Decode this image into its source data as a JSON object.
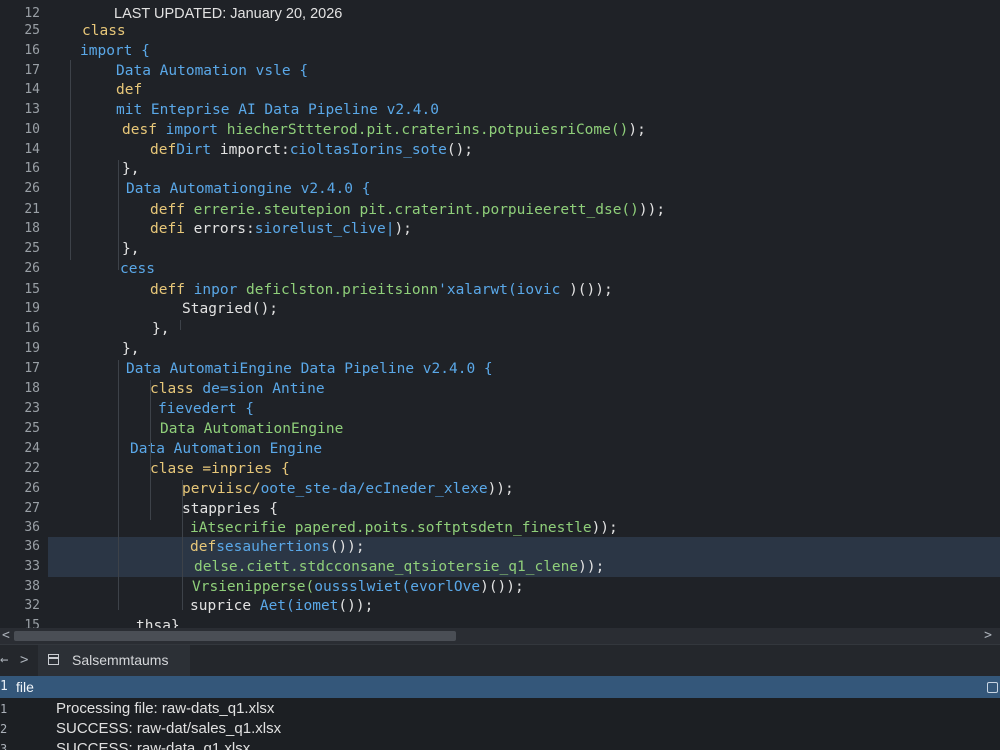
{
  "editor": {
    "lines": [
      {
        "n": "12",
        "segs": [
          {
            "t": "LAST UPDATED: January 20, 2026",
            "c": "c-white c-sans"
          }
        ]
      },
      {
        "n": "25",
        "segs": [
          {
            "t": "class",
            "c": "c-kw"
          }
        ]
      },
      {
        "n": "16",
        "segs": [
          {
            "t": "import {",
            "c": "c-blue"
          }
        ]
      },
      {
        "n": "17",
        "segs": [
          {
            "t": "Data Automation vsle {",
            "c": "c-blue"
          }
        ]
      },
      {
        "n": "14",
        "segs": [
          {
            "t": "def",
            "c": "c-kw"
          }
        ]
      },
      {
        "n": "13",
        "segs": [
          {
            "t": "mit Enteprise AI Data Pipeline v2.4.0",
            "c": "c-blue"
          }
        ]
      },
      {
        "n": "10",
        "segs": [
          {
            "t": "desf ",
            "c": "c-kw"
          },
          {
            "t": "import ",
            "c": "c-blue"
          },
          {
            "t": "hiecherSttterod.pit.craterins.potpuiesriCome()",
            "c": "c-green"
          },
          {
            "t": ");",
            "c": "c-white"
          }
        ]
      },
      {
        "n": "14",
        "segs": [
          {
            "t": "def",
            "c": "c-kw"
          },
          {
            "t": "Dirt ",
            "c": "c-blue"
          },
          {
            "t": "imporct:",
            "c": "c-white"
          },
          {
            "t": "cioltasIorins_sote",
            "c": "c-blue"
          },
          {
            "t": "();",
            "c": "c-white"
          }
        ]
      },
      {
        "n": "16",
        "segs": [
          {
            "t": "},",
            "c": "c-white"
          }
        ]
      },
      {
        "n": "26",
        "segs": [
          {
            "t": "Data Automationgine v2.4.0 {",
            "c": "c-blue"
          }
        ]
      },
      {
        "n": "21",
        "segs": [
          {
            "t": "deff ",
            "c": "c-kw"
          },
          {
            "t": "errerie.steutepion ",
            "c": "c-green"
          },
          {
            "t": "pit.craterint.porpuieerett_dse()",
            "c": "c-green"
          },
          {
            "t": "));",
            "c": "c-white"
          }
        ]
      },
      {
        "n": "18",
        "segs": [
          {
            "t": "defi ",
            "c": "c-kw"
          },
          {
            "t": "errors:",
            "c": "c-white"
          },
          {
            "t": "siorelust_clive|",
            "c": "c-blue"
          },
          {
            "t": ");",
            "c": "c-white"
          }
        ]
      },
      {
        "n": "25",
        "segs": [
          {
            "t": "},",
            "c": "c-white"
          }
        ]
      },
      {
        "n": "26",
        "segs": [
          {
            "t": "cess",
            "c": "c-blue"
          }
        ]
      },
      {
        "n": "15",
        "segs": [
          {
            "t": "deff ",
            "c": "c-kw"
          },
          {
            "t": "inpor ",
            "c": "c-blue"
          },
          {
            "t": "deficlston.prieitsionn",
            "c": "c-green"
          },
          {
            "t": "'xalarwt(iovic ",
            "c": "c-blue"
          },
          {
            "t": ")());",
            "c": "c-white"
          }
        ]
      },
      {
        "n": "19",
        "segs": [
          {
            "t": "Stagried",
            "c": "c-white"
          },
          {
            "t": "();",
            "c": "c-white"
          }
        ]
      },
      {
        "n": "16",
        "segs": [
          {
            "t": "},",
            "c": "c-white"
          }
        ]
      },
      {
        "n": "19",
        "segs": [
          {
            "t": "},",
            "c": "c-white"
          }
        ]
      },
      {
        "n": "17",
        "segs": [
          {
            "t": "Data AutomatiEngine Data Pipeline v2.4.0 {",
            "c": "c-blue"
          }
        ]
      },
      {
        "n": "18",
        "segs": [
          {
            "t": "class ",
            "c": "c-kw"
          },
          {
            "t": "de=sion Antine",
            "c": "c-blue"
          }
        ]
      },
      {
        "n": "23",
        "segs": [
          {
            "t": "fievedert {",
            "c": "c-blue"
          }
        ]
      },
      {
        "n": "25",
        "segs": [
          {
            "t": "Data AutomationEngine",
            "c": "c-green"
          }
        ]
      },
      {
        "n": "24",
        "segs": [
          {
            "t": "Data Automation Engine",
            "c": "c-blue"
          }
        ]
      },
      {
        "n": "22",
        "segs": [
          {
            "t": "clase =inpries {",
            "c": "c-kw"
          }
        ]
      },
      {
        "n": "26",
        "segs": [
          {
            "t": "perviisc/",
            "c": "c-kw"
          },
          {
            "t": "oote_ste-da/ecIneder_xlexe",
            "c": "c-blue"
          },
          {
            "t": "));",
            "c": "c-white"
          }
        ]
      },
      {
        "n": "27",
        "segs": [
          {
            "t": "stappries {",
            "c": "c-white"
          }
        ]
      },
      {
        "n": "36",
        "segs": [
          {
            "t": "iAtsecrifie papered.poits.softptsdetn_finestle",
            "c": "c-green"
          },
          {
            "t": "));",
            "c": "c-white"
          }
        ]
      },
      {
        "n": "36",
        "segs": [
          {
            "t": "def",
            "c": "c-kw"
          },
          {
            "t": "sesauhertions",
            "c": "c-blue"
          },
          {
            "t": "());",
            "c": "c-white"
          }
        ]
      },
      {
        "n": "33",
        "segs": [
          {
            "t": "delse.ciett.stdcconsane_qtsiotersie_q1_clene",
            "c": "c-green"
          },
          {
            "t": "));",
            "c": "c-white"
          }
        ]
      },
      {
        "n": "38",
        "segs": [
          {
            "t": "Vrsienipperse(",
            "c": "c-green"
          },
          {
            "t": "oussslwiet(evorlOve",
            "c": "c-blue"
          },
          {
            "t": ")());",
            "c": "c-white"
          }
        ]
      },
      {
        "n": "32",
        "segs": [
          {
            "t": "suprice ",
            "c": "c-white"
          },
          {
            "t": "Aet(iomet",
            "c": "c-blue"
          },
          {
            "t": "());",
            "c": "c-white"
          }
        ]
      },
      {
        "n": "15",
        "segs": [
          {
            "t": "thsa",
            "c": "c-white"
          },
          {
            "t": "}",
            "c": "c-white"
          }
        ]
      }
    ]
  },
  "panel": {
    "back_arrow": "←",
    "forward_arrow": ">",
    "tab_label": "Salsemmtaums",
    "file_bar_number": "1",
    "file_bar_label": "file",
    "output_lines": [
      {
        "n": "1",
        "text": "Processing file: raw-dats_q1.xlsx"
      },
      {
        "n": "2",
        "text": "SUCCESS: raw-dat/sales_q1.xlsx"
      },
      {
        "n": "3",
        "text": "SUCCESS: raw-data_q1.xlsx"
      }
    ]
  },
  "scrollbar": {
    "left_arrow": "<",
    "right_arrow": ">"
  },
  "colors": {
    "keyword": "#e7c779",
    "identifier": "#5aa8e8",
    "string": "#8fcf7a",
    "file_bar": "#34577a",
    "highlight": "#2b3645"
  },
  "icons": {
    "panel_tab": "terminal-icon",
    "file_bar": "maximize-icon"
  }
}
